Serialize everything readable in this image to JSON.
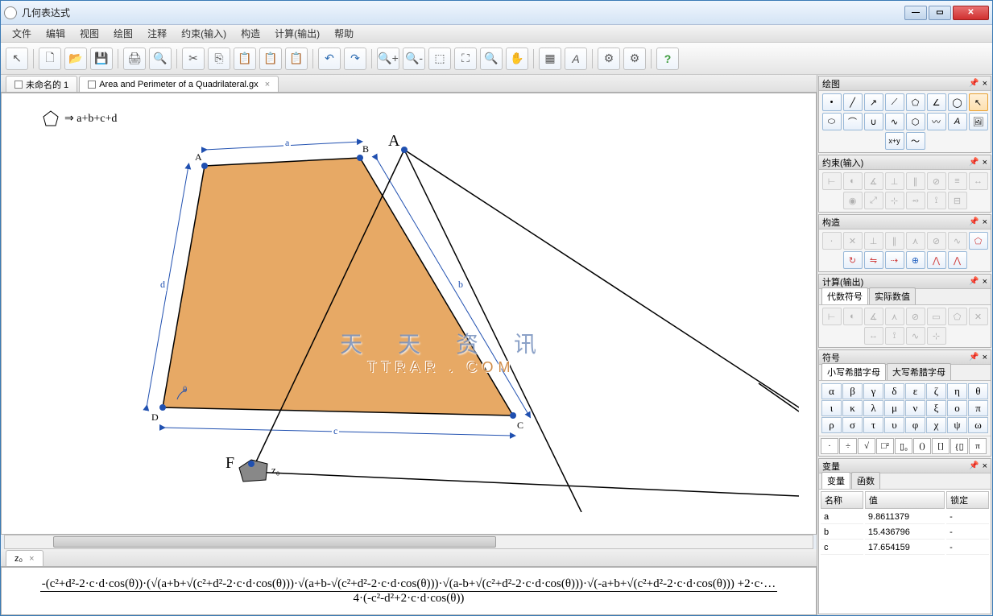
{
  "window": {
    "title": "几何表达式"
  },
  "menu": [
    "文件",
    "编辑",
    "视图",
    "绘图",
    "注释",
    "约束(输入)",
    "构造",
    "计算(输出)",
    "帮助"
  ],
  "tabs": [
    {
      "label": "未命名的 1",
      "active": false
    },
    {
      "label": "Area and Perimeter of a Quadrilateral.gx",
      "active": true
    }
  ],
  "canvas": {
    "formula_label": "⇒ a+b+c+d",
    "points": {
      "A": "A",
      "B": "B",
      "C": "C",
      "D": "D",
      "A2": "A",
      "F": "F",
      "z0": "z₀"
    },
    "edges": {
      "a": "a",
      "b": "b",
      "c": "c",
      "d": "d",
      "theta": "θ"
    }
  },
  "formula_tab": "z₀",
  "formula": {
    "numerator": "-(c²+d²-2·c·d·cos(θ))·(√(a+b+√(c²+d²-2·c·d·cos(θ)))·√(a+b-√(c²+d²-2·c·d·cos(θ)))·√(a-b+√(c²+d²-2·c·d·cos(θ)))·√(-a+b+√(c²+d²-2·c·d·cos(θ))) +2·c·…",
    "denominator": "4·(-c²-d²+2·c·d·cos(θ))"
  },
  "panels": {
    "draw": "绘图",
    "constraint": "约束(输入)",
    "construct": "构造",
    "compute": "计算(输出)",
    "compute_tabs": [
      "代数符号",
      "实际数值"
    ],
    "symbol": "符号",
    "symbol_tabs": [
      "小写希腊字母",
      "大写希腊字母"
    ],
    "greek_lower": [
      "α",
      "β",
      "γ",
      "δ",
      "ε",
      "ζ",
      "η",
      "θ",
      "ι",
      "κ",
      "λ",
      "μ",
      "ν",
      "ξ",
      "ο",
      "π",
      "ρ",
      "σ",
      "τ",
      "υ",
      "φ",
      "χ",
      "ψ",
      "ω"
    ],
    "math_ops": [
      "·",
      "÷",
      "√",
      "□²",
      "▯₀",
      "()",
      "[]",
      "{▯",
      "π"
    ],
    "vars": "变量",
    "vars_tabs": [
      "变量",
      "函数"
    ],
    "vars_headers": [
      "名称",
      "值",
      "锁定"
    ],
    "vars_rows": [
      {
        "name": "a",
        "val": "9.8611379",
        "lock": "-"
      },
      {
        "name": "b",
        "val": "15.436796",
        "lock": "-"
      },
      {
        "name": "c",
        "val": "17.654159",
        "lock": "-"
      }
    ]
  },
  "watermark": {
    "line1": "天　天　资　讯",
    "line2": "TTRAR . COM"
  }
}
